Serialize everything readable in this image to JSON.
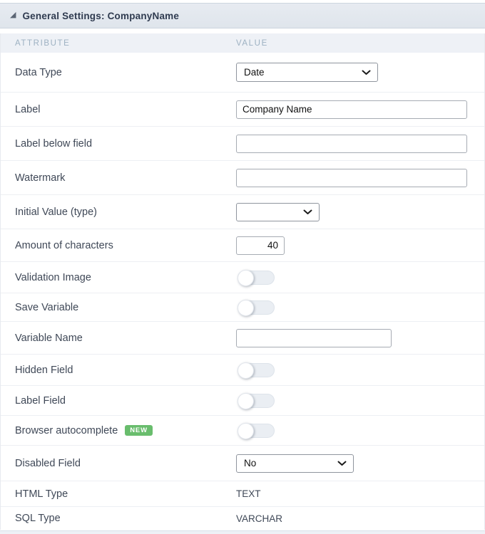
{
  "section": {
    "title": "General Settings: CompanyName",
    "collapse_icon": "triangle-se"
  },
  "table_headers": {
    "attribute": "ATTRIBUTE",
    "value": "VALUE"
  },
  "rows": [
    {
      "label": "Data Type",
      "control": "select",
      "value": "Date"
    },
    {
      "label": "Label",
      "control": "text",
      "value": "Company Name"
    },
    {
      "label": "Label below field",
      "control": "text",
      "value": ""
    },
    {
      "label": "Watermark",
      "control": "text",
      "value": ""
    },
    {
      "label": "Initial Value (type)",
      "control": "select",
      "value": ""
    },
    {
      "label": "Amount of characters",
      "control": "text",
      "value": "40"
    },
    {
      "label": "Validation Image",
      "control": "toggle",
      "state": "off"
    },
    {
      "label": "Save Variable",
      "control": "toggle",
      "state": "off"
    },
    {
      "label": "Variable Name",
      "control": "text",
      "value": ""
    },
    {
      "label": "Hidden Field",
      "control": "toggle",
      "state": "off"
    },
    {
      "label": "Label Field",
      "control": "toggle",
      "state": "off"
    },
    {
      "label": "Browser autocomplete",
      "control": "toggle",
      "state": "off",
      "badge": "NEW"
    },
    {
      "label": "Disabled Field",
      "control": "select",
      "value": "No"
    },
    {
      "label": "HTML Type",
      "control": "static",
      "value": "TEXT"
    },
    {
      "label": "SQL Type",
      "control": "static",
      "value": "VARCHAR"
    }
  ],
  "colors": {
    "header_bg": "#e2e7ee",
    "header_text": "#2f3b50",
    "thead_bg": "#eef1f6",
    "thead_text": "#9db1c2",
    "label_text": "#3f4857",
    "badge_green": "#69bd6d",
    "toggle_track": "#eaeef3",
    "row_separator": "#edeff3"
  }
}
